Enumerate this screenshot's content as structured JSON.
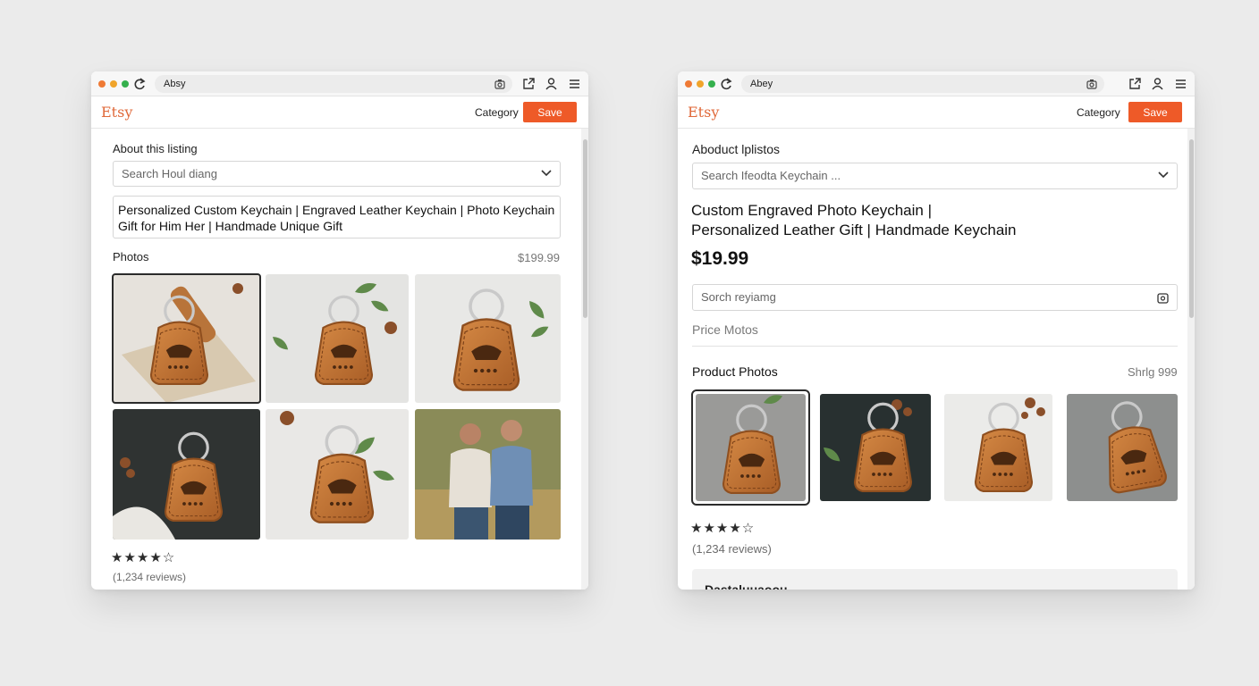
{
  "left": {
    "browser": {
      "address": "Absy"
    },
    "header": {
      "logo": "Etsy",
      "category": "Category",
      "save_label": "Save"
    },
    "listing": {
      "section_label": "About this listing",
      "search_placeholder": "Search Houl diang",
      "title_line1": "Personalized Custom Keychain | Engraved Leather Keychain | Photo Keychain |",
      "title_line2": "Gift for Him Her | Handmade Unique Gift",
      "photos_label": "Photos",
      "price": "$199.99",
      "rating": "★★★★☆",
      "rating_value": 4,
      "reviews": "(1,234 reviews)"
    }
  },
  "right": {
    "browser": {
      "address": "Abey"
    },
    "header": {
      "logo": "Etsy",
      "category": "Category",
      "save_label": "Save"
    },
    "listing": {
      "section_label": "Abоduct lplistos",
      "search_placeholder": "Search Ifeodta Keychain ...",
      "title_line1": "Custom Engraved Photo Keychain |",
      "title_line2": "Personalized Leather Gift | Handmade Keychain",
      "price": "$19.99",
      "review_search_placeholder": "Sorch reyiamg",
      "price_photos": "Price Motos",
      "photos_label": "Product Photos",
      "shipping": "Shrlg 999",
      "rating": "★★★★☆",
      "rating_value": 4,
      "reviews": "(1,234 reviews)",
      "bottom_section": "Dastaluuaoou"
    }
  },
  "colors": {
    "accent": "#ee5a28",
    "logo": "#e0693a",
    "leather": "#c0773a"
  },
  "icons": [
    "reload-icon",
    "screenshot-icon",
    "share-icon",
    "user-icon",
    "menu-icon",
    "chevron-down-icon",
    "camera-icon",
    "star-icon"
  ]
}
